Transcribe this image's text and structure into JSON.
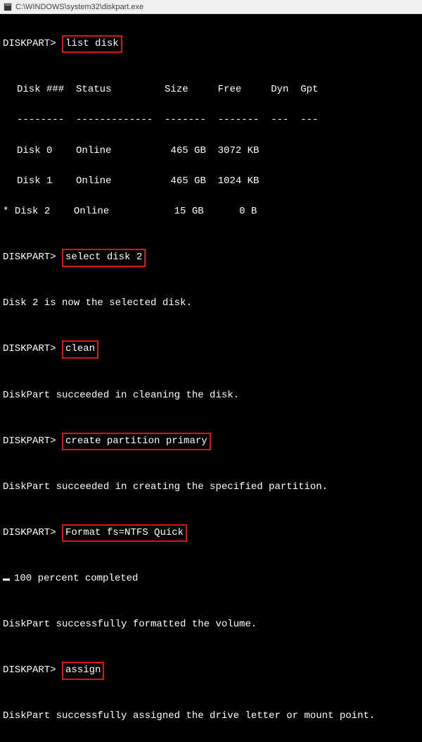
{
  "titlebar": {
    "text": "C:\\WINDOWS\\system32\\diskpart.exe"
  },
  "prompt": "DISKPART>",
  "commands": {
    "cmd1": "list disk",
    "cmd2": "select disk 2",
    "cmd3": "clean",
    "cmd4": "create partition primary",
    "cmd5": "Format fs=NTFS Quick",
    "cmd6": "assign"
  },
  "output": {
    "header": "Disk ###  Status         Size     Free     Dyn  Gpt",
    "divider": "--------  -------------  -------  -------  ---  ---",
    "row0": "Disk 0    Online          465 GB  3072 KB",
    "row1": "Disk 1    Online          465 GB  1024 KB",
    "row2_prefix": "* ",
    "row2": "Disk 2    Online           15 GB      0 B",
    "select_msg": "Disk 2 is now the selected disk.",
    "clean_msg": "DiskPart succeeded in cleaning the disk.",
    "create_msg": "DiskPart succeeded in creating the specified partition.",
    "progress": "100 percent completed",
    "format_msg": "DiskPart successfully formatted the volume.",
    "assign_msg": "DiskPart successfully assigned the drive letter or mount point."
  }
}
